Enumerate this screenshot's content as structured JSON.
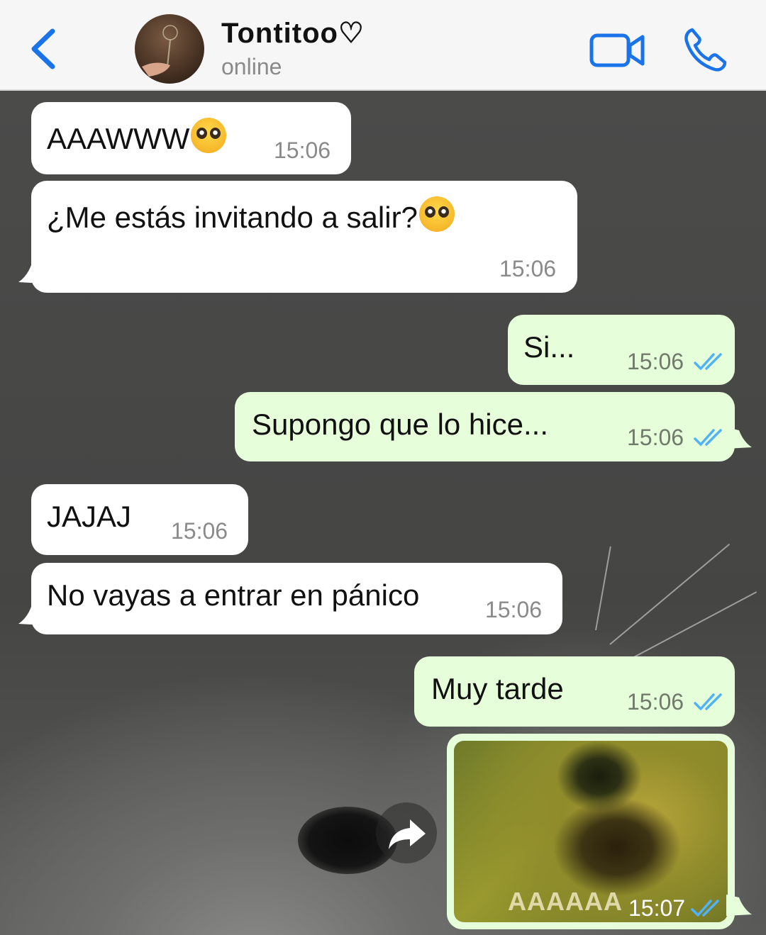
{
  "header": {
    "back_icon": "chevron-left-icon",
    "contact_name": "Tontitoo♡",
    "status": "online",
    "video_icon": "video-camera-icon",
    "call_icon": "phone-icon",
    "accent_color": "#1a73e8"
  },
  "messages": [
    {
      "direction": "in",
      "text": "AAAWWW",
      "emoji": "pleading-face",
      "time": "15:06"
    },
    {
      "direction": "in",
      "text": "¿Me estás invitando a salir?",
      "emoji": "pleading-face",
      "time": "15:06"
    },
    {
      "direction": "out",
      "text": "Si...",
      "time": "15:06",
      "status": "read"
    },
    {
      "direction": "out",
      "text": "Supongo que lo hice...",
      "time": "15:06",
      "status": "read"
    },
    {
      "direction": "in",
      "text": "JAJAJ",
      "time": "15:06"
    },
    {
      "direction": "in",
      "text": "No vayas a entrar en pánico",
      "time": "15:06"
    },
    {
      "direction": "out",
      "text": "Muy tarde",
      "time": "15:06",
      "status": "read"
    },
    {
      "direction": "out",
      "type": "image",
      "caption_in_image": "AAAAAA",
      "time": "15:07",
      "status": "read"
    }
  ],
  "colors": {
    "incoming_bubble": "#ffffff",
    "outgoing_bubble": "#e6ffda",
    "read_ticks": "#4fb3f6"
  },
  "forward_icon": "forward-arrow-icon"
}
